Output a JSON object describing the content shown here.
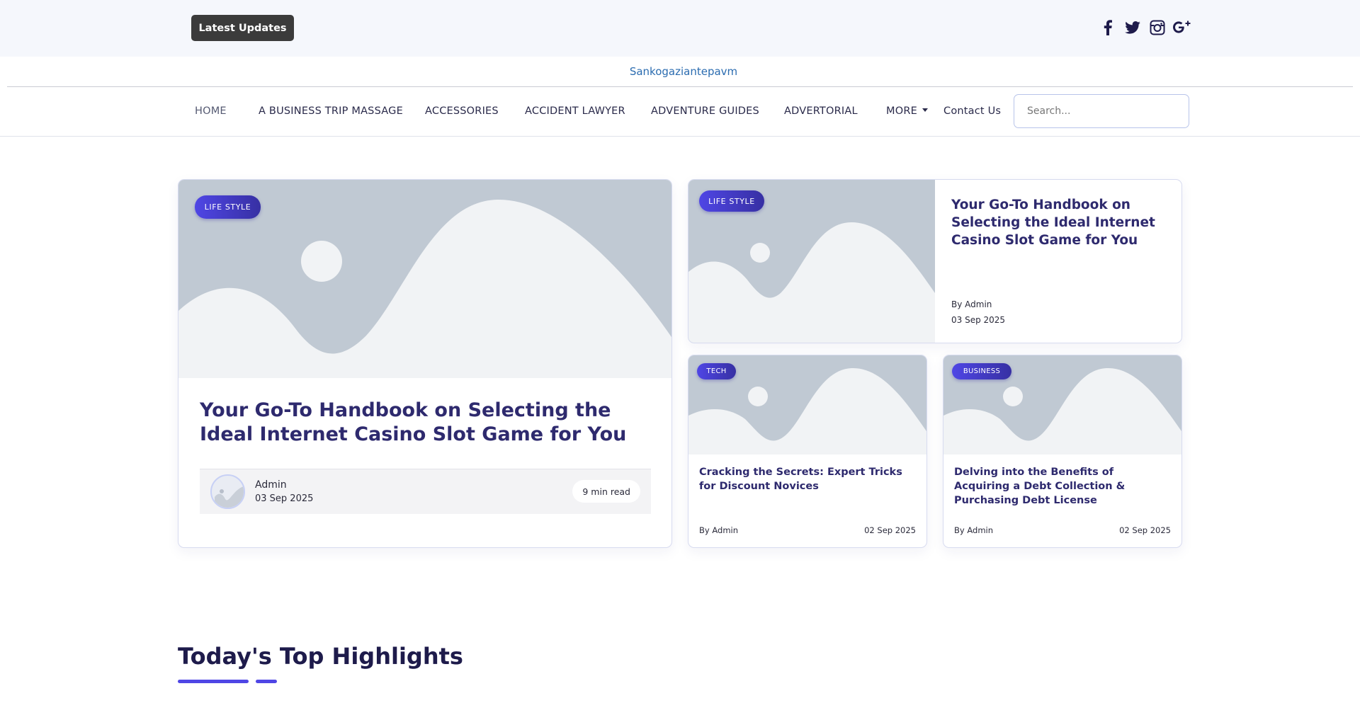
{
  "topbar": {
    "latest_updates_label": "Latest Updates",
    "social_icons": [
      "facebook-icon",
      "twitter-icon",
      "instagram-icon",
      "google-plus-icon"
    ]
  },
  "site": {
    "name": "Sankogaziantepavm"
  },
  "nav": {
    "items": [
      "HOME",
      "A BUSINESS TRIP MASSAGE",
      "ACCESSORIES",
      "ACCIDENT LAWYER",
      "ADVENTURE GUIDES",
      "ADVERTORIAL",
      "MORE",
      "Contact Us"
    ],
    "search_placeholder": "Search..."
  },
  "featured": {
    "main": {
      "category": "LIFE STYLE",
      "title": "Your Go-To Handbook on Selecting the Ideal Internet Casino Slot Game for You",
      "author": "Admin",
      "date": "03 Sep 2025",
      "read_time": "9 min read"
    },
    "side": {
      "category": "LIFE STYLE",
      "title": "Your Go-To Handbook on Selecting the Ideal Internet Casino Slot Game for You",
      "by": "By Admin",
      "date": "03 Sep 2025"
    },
    "small": [
      {
        "category": "TECH",
        "title": "Cracking the Secrets: Expert Tricks for Discount Novices",
        "by": "By Admin",
        "date": "02 Sep 2025"
      },
      {
        "category": "BUSINESS",
        "title": "Delving into the Benefits of Acquiring a Debt Collection & Purchasing Debt License",
        "by": "By Admin",
        "date": "02 Sep 2025"
      }
    ]
  },
  "highlights": {
    "title": "Today's Top Highlights"
  },
  "colors": {
    "accent": "#4f46e5",
    "title": "#2e2a6e",
    "placeholder": "#c0c9d3"
  }
}
